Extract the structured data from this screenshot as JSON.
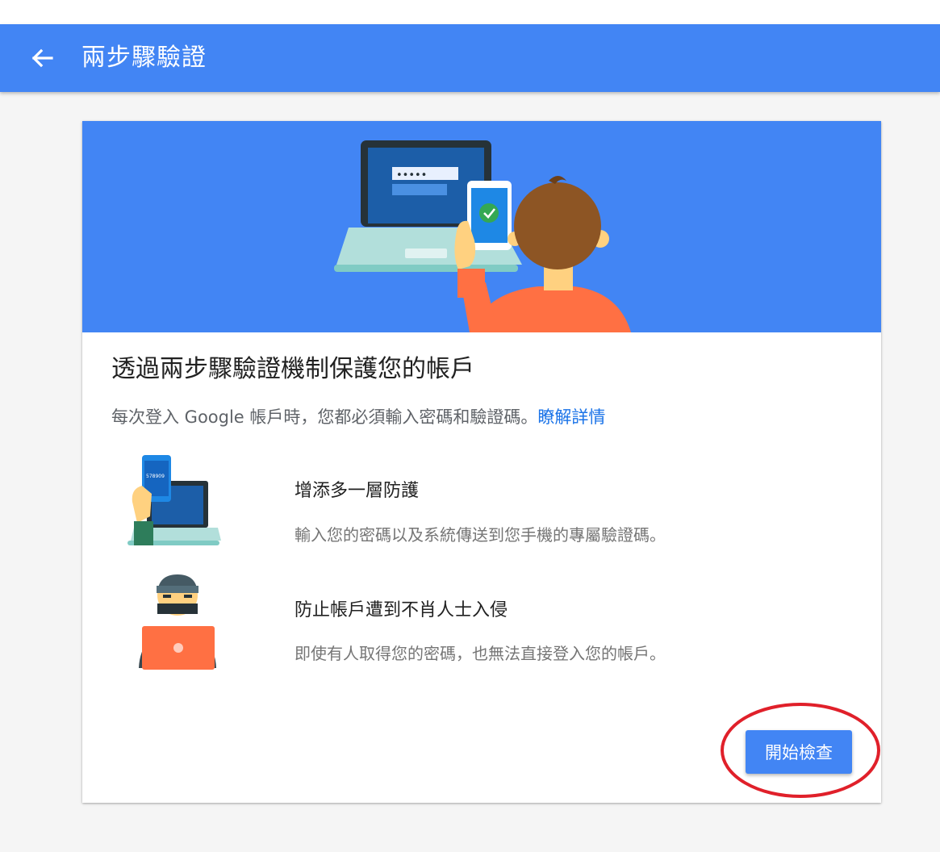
{
  "app_bar": {
    "back_icon": "arrow-back-icon",
    "title": "兩步驟驗證"
  },
  "hero": {
    "password_mask": "•••••"
  },
  "card": {
    "title": "透過兩步驟驗證機制保護您的帳戶",
    "description": "每次登入 Google 帳戶時，您都必須輸入密碼和驗證碼。",
    "learn_more": "瞭解詳情",
    "features": [
      {
        "icon": "phone-code-laptop-illustration",
        "phone_code": "578909",
        "title": "增添多一層防護",
        "text": "輸入您的密碼以及系統傳送到您手機的專屬驗證碼。"
      },
      {
        "icon": "hacker-laptop-illustration",
        "title": "防止帳戶遭到不肖人士入侵",
        "text": "即使有人取得您的密碼，也無法直接登入您的帳戶。"
      }
    ],
    "start_button": "開始檢查"
  },
  "colors": {
    "primary": "#4285f4",
    "link": "#1a73e8",
    "annotation_circle": "#e0202a"
  }
}
